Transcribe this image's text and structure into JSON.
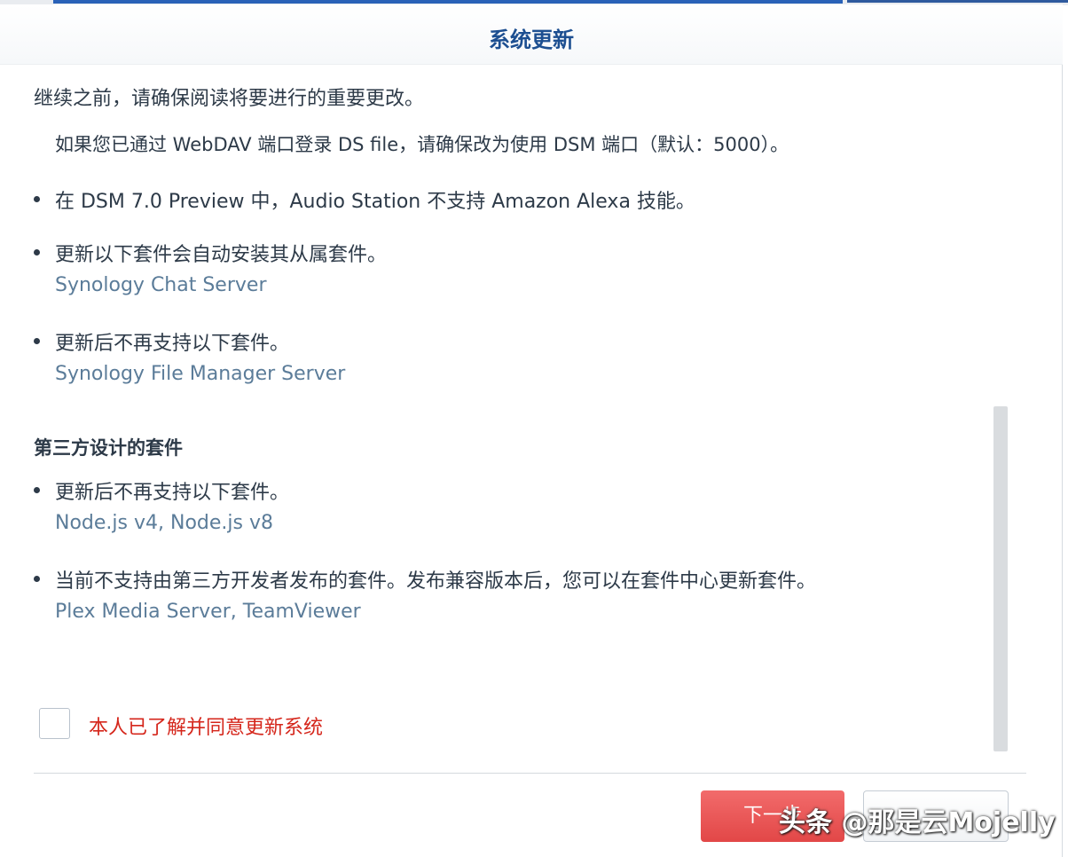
{
  "dialog": {
    "title": "系统更新",
    "intro": "继续之前，请确保阅读将要进行的重要更改。"
  },
  "content": {
    "cut_off_line": "如果您已通过 WebDAV 端口登录 DS file，请确保改为使用 DSM 端口（默认：5000）。",
    "items": [
      {
        "text": "在 DSM 7.0 Preview 中，Audio Station 不支持 Amazon Alexa 技能。",
        "packages": ""
      },
      {
        "text": "更新以下套件会自动安装其从属套件。",
        "packages": "Synology Chat Server"
      },
      {
        "text": "更新后不再支持以下套件。",
        "packages": "Synology File Manager Server"
      }
    ],
    "third_party": {
      "heading": "第三方设计的套件",
      "items": [
        {
          "text": "更新后不再支持以下套件。",
          "packages": "Node.js v4, Node.js v8"
        },
        {
          "text": "当前不支持由第三方开发者发布的套件。发布兼容版本后，您可以在套件中心更新套件。",
          "packages": "Plex Media Server, TeamViewer"
        }
      ]
    }
  },
  "agree": {
    "label": "本人已了解并同意更新系统",
    "checked": false
  },
  "buttons": {
    "next_label": "下一步",
    "cancel_label": ""
  },
  "watermark": "头条 @那是云Mojelly",
  "colors": {
    "title": "#1d4f91",
    "package_link": "#5b7c99",
    "agree_label": "#d5261b",
    "next_button": "#e24747"
  }
}
